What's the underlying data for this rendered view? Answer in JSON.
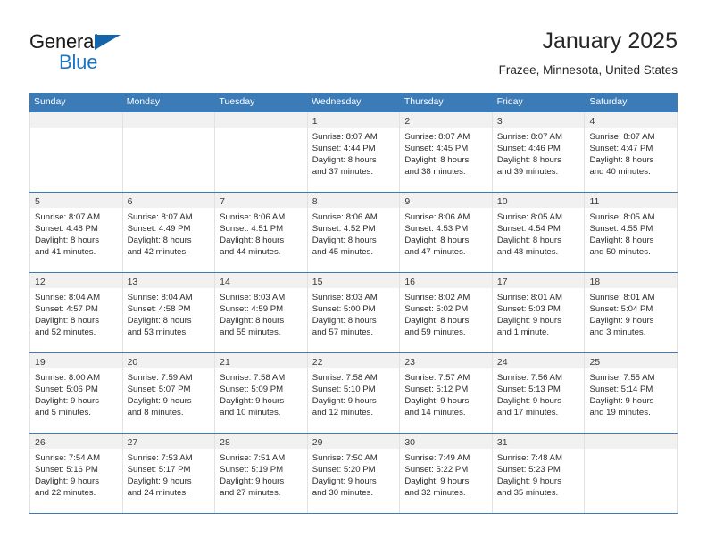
{
  "brand": {
    "word1": "General",
    "word2": "Blue",
    "triangle_color": "#1464aa",
    "blue_color": "#1b76c6"
  },
  "header": {
    "title": "January 2025",
    "subtitle": "Frazee, Minnesota, United States"
  },
  "theme": {
    "header_blue": "#3b7cb8",
    "daynum_bg": "#f1f1f1",
    "grid_line": "#e2e2e2",
    "text": "#2b2b2b"
  },
  "weekdays": [
    "Sunday",
    "Monday",
    "Tuesday",
    "Wednesday",
    "Thursday",
    "Friday",
    "Saturday"
  ],
  "labels": {
    "sunrise_prefix": "Sunrise:",
    "sunset_prefix": "Sunset:",
    "daylight_prefix": "Daylight:"
  },
  "weeks": [
    [
      {
        "empty": true
      },
      {
        "empty": true
      },
      {
        "empty": true
      },
      {
        "day": "1",
        "l1": "Sunrise: 8:07 AM",
        "l2": "Sunset: 4:44 PM",
        "l3": "Daylight: 8 hours",
        "l4": "and 37 minutes."
      },
      {
        "day": "2",
        "l1": "Sunrise: 8:07 AM",
        "l2": "Sunset: 4:45 PM",
        "l3": "Daylight: 8 hours",
        "l4": "and 38 minutes."
      },
      {
        "day": "3",
        "l1": "Sunrise: 8:07 AM",
        "l2": "Sunset: 4:46 PM",
        "l3": "Daylight: 8 hours",
        "l4": "and 39 minutes."
      },
      {
        "day": "4",
        "l1": "Sunrise: 8:07 AM",
        "l2": "Sunset: 4:47 PM",
        "l3": "Daylight: 8 hours",
        "l4": "and 40 minutes."
      }
    ],
    [
      {
        "day": "5",
        "l1": "Sunrise: 8:07 AM",
        "l2": "Sunset: 4:48 PM",
        "l3": "Daylight: 8 hours",
        "l4": "and 41 minutes."
      },
      {
        "day": "6",
        "l1": "Sunrise: 8:07 AM",
        "l2": "Sunset: 4:49 PM",
        "l3": "Daylight: 8 hours",
        "l4": "and 42 minutes."
      },
      {
        "day": "7",
        "l1": "Sunrise: 8:06 AM",
        "l2": "Sunset: 4:51 PM",
        "l3": "Daylight: 8 hours",
        "l4": "and 44 minutes."
      },
      {
        "day": "8",
        "l1": "Sunrise: 8:06 AM",
        "l2": "Sunset: 4:52 PM",
        "l3": "Daylight: 8 hours",
        "l4": "and 45 minutes."
      },
      {
        "day": "9",
        "l1": "Sunrise: 8:06 AM",
        "l2": "Sunset: 4:53 PM",
        "l3": "Daylight: 8 hours",
        "l4": "and 47 minutes."
      },
      {
        "day": "10",
        "l1": "Sunrise: 8:05 AM",
        "l2": "Sunset: 4:54 PM",
        "l3": "Daylight: 8 hours",
        "l4": "and 48 minutes."
      },
      {
        "day": "11",
        "l1": "Sunrise: 8:05 AM",
        "l2": "Sunset: 4:55 PM",
        "l3": "Daylight: 8 hours",
        "l4": "and 50 minutes."
      }
    ],
    [
      {
        "day": "12",
        "l1": "Sunrise: 8:04 AM",
        "l2": "Sunset: 4:57 PM",
        "l3": "Daylight: 8 hours",
        "l4": "and 52 minutes."
      },
      {
        "day": "13",
        "l1": "Sunrise: 8:04 AM",
        "l2": "Sunset: 4:58 PM",
        "l3": "Daylight: 8 hours",
        "l4": "and 53 minutes."
      },
      {
        "day": "14",
        "l1": "Sunrise: 8:03 AM",
        "l2": "Sunset: 4:59 PM",
        "l3": "Daylight: 8 hours",
        "l4": "and 55 minutes."
      },
      {
        "day": "15",
        "l1": "Sunrise: 8:03 AM",
        "l2": "Sunset: 5:00 PM",
        "l3": "Daylight: 8 hours",
        "l4": "and 57 minutes."
      },
      {
        "day": "16",
        "l1": "Sunrise: 8:02 AM",
        "l2": "Sunset: 5:02 PM",
        "l3": "Daylight: 8 hours",
        "l4": "and 59 minutes."
      },
      {
        "day": "17",
        "l1": "Sunrise: 8:01 AM",
        "l2": "Sunset: 5:03 PM",
        "l3": "Daylight: 9 hours",
        "l4": "and 1 minute."
      },
      {
        "day": "18",
        "l1": "Sunrise: 8:01 AM",
        "l2": "Sunset: 5:04 PM",
        "l3": "Daylight: 9 hours",
        "l4": "and 3 minutes."
      }
    ],
    [
      {
        "day": "19",
        "l1": "Sunrise: 8:00 AM",
        "l2": "Sunset: 5:06 PM",
        "l3": "Daylight: 9 hours",
        "l4": "and 5 minutes."
      },
      {
        "day": "20",
        "l1": "Sunrise: 7:59 AM",
        "l2": "Sunset: 5:07 PM",
        "l3": "Daylight: 9 hours",
        "l4": "and 8 minutes."
      },
      {
        "day": "21",
        "l1": "Sunrise: 7:58 AM",
        "l2": "Sunset: 5:09 PM",
        "l3": "Daylight: 9 hours",
        "l4": "and 10 minutes."
      },
      {
        "day": "22",
        "l1": "Sunrise: 7:58 AM",
        "l2": "Sunset: 5:10 PM",
        "l3": "Daylight: 9 hours",
        "l4": "and 12 minutes."
      },
      {
        "day": "23",
        "l1": "Sunrise: 7:57 AM",
        "l2": "Sunset: 5:12 PM",
        "l3": "Daylight: 9 hours",
        "l4": "and 14 minutes."
      },
      {
        "day": "24",
        "l1": "Sunrise: 7:56 AM",
        "l2": "Sunset: 5:13 PM",
        "l3": "Daylight: 9 hours",
        "l4": "and 17 minutes."
      },
      {
        "day": "25",
        "l1": "Sunrise: 7:55 AM",
        "l2": "Sunset: 5:14 PM",
        "l3": "Daylight: 9 hours",
        "l4": "and 19 minutes."
      }
    ],
    [
      {
        "day": "26",
        "l1": "Sunrise: 7:54 AM",
        "l2": "Sunset: 5:16 PM",
        "l3": "Daylight: 9 hours",
        "l4": "and 22 minutes."
      },
      {
        "day": "27",
        "l1": "Sunrise: 7:53 AM",
        "l2": "Sunset: 5:17 PM",
        "l3": "Daylight: 9 hours",
        "l4": "and 24 minutes."
      },
      {
        "day": "28",
        "l1": "Sunrise: 7:51 AM",
        "l2": "Sunset: 5:19 PM",
        "l3": "Daylight: 9 hours",
        "l4": "and 27 minutes."
      },
      {
        "day": "29",
        "l1": "Sunrise: 7:50 AM",
        "l2": "Sunset: 5:20 PM",
        "l3": "Daylight: 9 hours",
        "l4": "and 30 minutes."
      },
      {
        "day": "30",
        "l1": "Sunrise: 7:49 AM",
        "l2": "Sunset: 5:22 PM",
        "l3": "Daylight: 9 hours",
        "l4": "and 32 minutes."
      },
      {
        "day": "31",
        "l1": "Sunrise: 7:48 AM",
        "l2": "Sunset: 5:23 PM",
        "l3": "Daylight: 9 hours",
        "l4": "and 35 minutes."
      },
      {
        "empty": true
      }
    ]
  ]
}
